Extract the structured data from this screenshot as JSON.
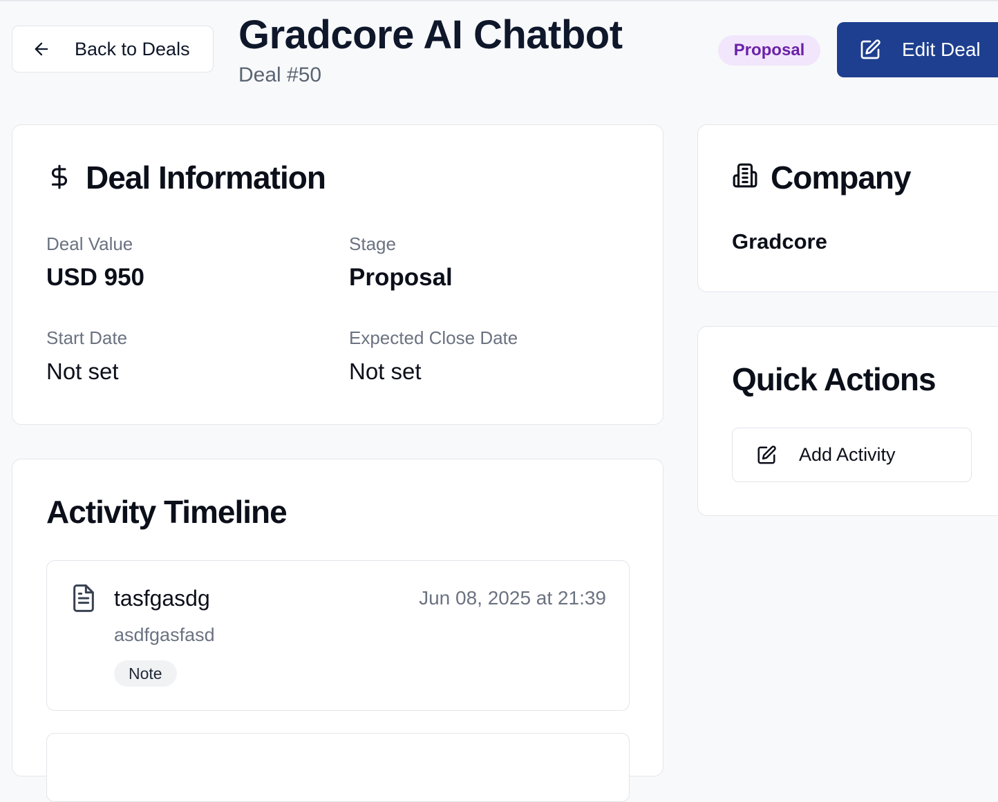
{
  "header": {
    "back_label": "Back to Deals",
    "title": "Gradcore AI Chatbot",
    "subtitle": "Deal #50",
    "stage_badge": "Proposal",
    "edit_label": "Edit Deal"
  },
  "deal_info": {
    "title": "Deal Information",
    "icon": "dollar-icon",
    "fields": [
      {
        "label": "Deal Value",
        "value": "USD 950"
      },
      {
        "label": "Stage",
        "value": "Proposal"
      },
      {
        "label": "Start Date",
        "value": "Not set"
      },
      {
        "label": "Expected Close Date",
        "value": "Not set"
      }
    ]
  },
  "company": {
    "title": "Company",
    "icon": "building-icon",
    "name": "Gradcore"
  },
  "quick_actions": {
    "title": "Quick Actions",
    "add_activity_label": "Add Activity"
  },
  "activity": {
    "title": "Activity Timeline",
    "items": [
      {
        "icon": "document-icon",
        "title": "tasfgasdg",
        "timestamp": "Jun 08, 2025 at 21:39",
        "description": "asdfgasfasd",
        "type": "Note"
      }
    ]
  },
  "colors": {
    "primary": "#1e3f8f",
    "badge_bg": "#f1e6fb",
    "badge_text": "#6b21a8",
    "background": "#f8f9fb"
  }
}
